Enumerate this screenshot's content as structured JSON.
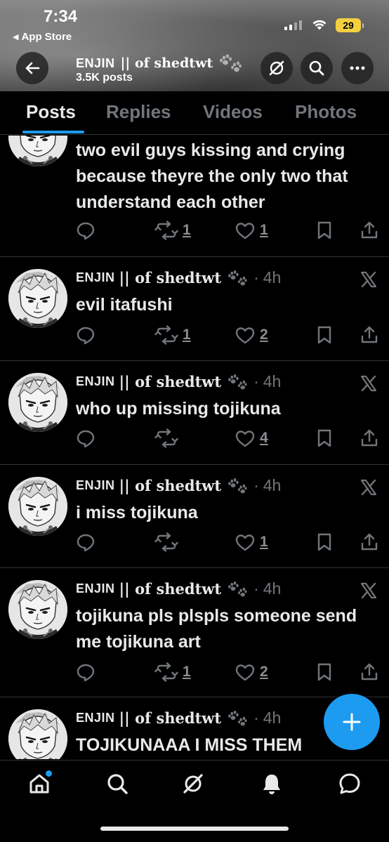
{
  "status_bar": {
    "time": "7:34",
    "back_app": "App Store",
    "battery": "29"
  },
  "header": {
    "name_caps": "ENJIN",
    "name_rest": "|| of shedtwt",
    "name_emoji": "paw-prints",
    "posts_count": "3.5K posts"
  },
  "tabs": [
    {
      "label": "Posts",
      "active": true
    },
    {
      "label": "Replies",
      "active": false
    },
    {
      "label": "Videos",
      "active": false
    },
    {
      "label": "Photos",
      "active": false
    }
  ],
  "author": {
    "name_caps": "ENJIN",
    "name_rest": "|| of shedtwt",
    "separator": "·"
  },
  "posts": [
    {
      "text": "two evil guys kissing and crying because theyre the only two that understand each other",
      "time": "",
      "reposts": "1",
      "likes": "1"
    },
    {
      "text": "evil itafushi",
      "time": "4h",
      "reposts": "1",
      "likes": "2"
    },
    {
      "text": "who up missing tojikuna",
      "time": "4h",
      "reposts": "",
      "likes": "4"
    },
    {
      "text": "i miss tojikuna",
      "time": "4h",
      "reposts": "",
      "likes": "1"
    },
    {
      "text": "tojikuna pls plspls someone send me tojikuna art",
      "time": "4h",
      "reposts": "1",
      "likes": "2"
    },
    {
      "text": "TOJIKUNAAA I MISS THEM",
      "time": "4h",
      "reposts": "",
      "likes": ""
    }
  ],
  "fab": {
    "icon": "plus-icon"
  },
  "bottom_nav": [
    {
      "icon": "home-icon",
      "active": true
    },
    {
      "icon": "search-icon",
      "active": false
    },
    {
      "icon": "grok-icon",
      "active": false
    },
    {
      "icon": "bell-icon",
      "active": false
    },
    {
      "icon": "messages-icon",
      "active": false
    }
  ],
  "colors": {
    "accent": "#1d9bf0",
    "muted": "#71767b",
    "text": "#e7e9ea",
    "battery": "#f4d03f"
  }
}
